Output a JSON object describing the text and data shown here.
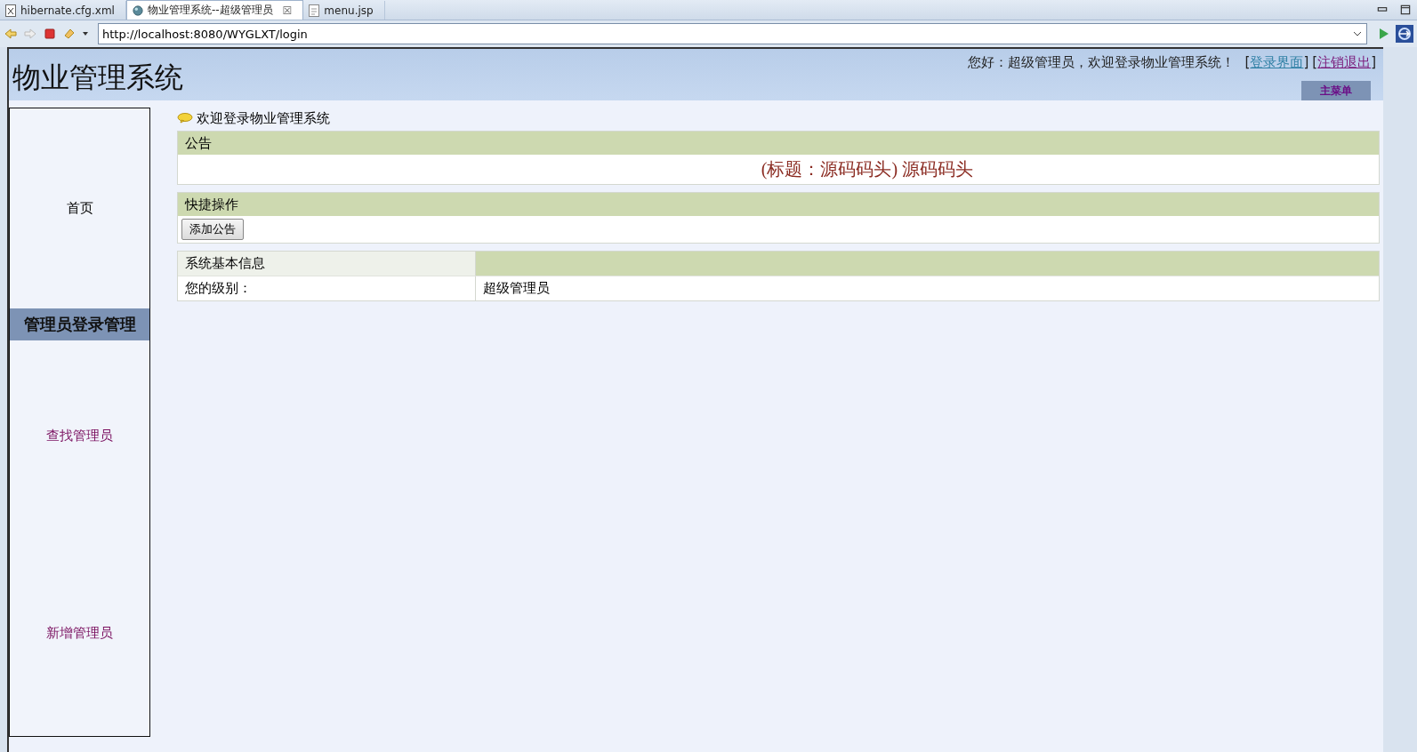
{
  "editor_tabs": [
    {
      "label": "hibernate.cfg.xml",
      "kind": "xml",
      "selected": false
    },
    {
      "label": "物业管理系统--超级管理员",
      "kind": "browser",
      "selected": true,
      "close": "☒"
    },
    {
      "label": "menu.jsp",
      "kind": "jsp",
      "selected": false
    }
  ],
  "address_bar": {
    "value": "http://localhost:8080/WYGLXT/login"
  },
  "header": {
    "title": "物业管理系统",
    "greeting": "您好：超级管理员，欢迎登录物业管理系统！",
    "links": [
      {
        "open": "[",
        "label": "登录界面",
        "close": "]",
        "visited": false
      },
      {
        "open": "[",
        "label": "注销退出",
        "close": "]",
        "visited": true
      }
    ],
    "menu_button": "主菜单"
  },
  "sidebar": {
    "items": [
      {
        "label": "首页",
        "kind": "link",
        "visited": false
      },
      {
        "label": "管理员登录管理",
        "kind": "section"
      },
      {
        "label": "查找管理员",
        "kind": "link",
        "visited": true
      },
      {
        "label": "新增管理员",
        "kind": "link",
        "visited": true
      }
    ]
  },
  "welcome": "欢迎登录物业管理系统",
  "notice": {
    "heading": "公告",
    "text": "(标题：源码码头) 源码码头"
  },
  "quick_actions": {
    "heading": "快捷操作",
    "buttons": [
      "添加公告"
    ]
  },
  "system_info": {
    "heading": "系统基本信息",
    "rows": [
      {
        "label": "您的级别：",
        "value": "超级管理员"
      }
    ]
  }
}
